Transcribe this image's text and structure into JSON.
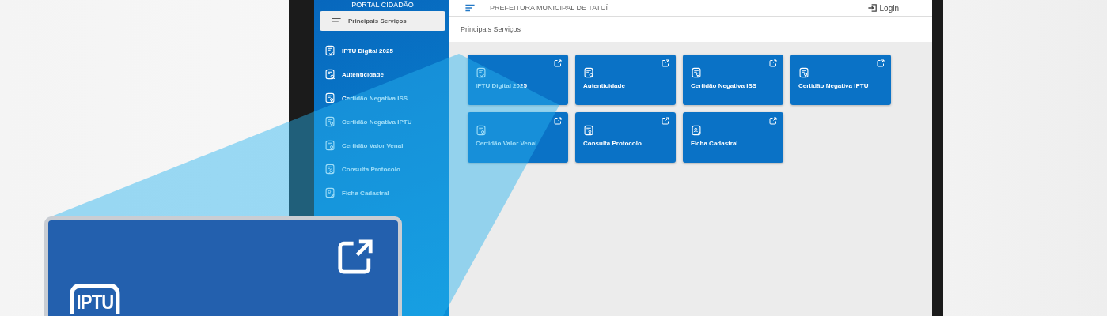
{
  "header": {
    "title": "PREFEITURA MUNICIPAL DE TATUÍ",
    "login": "Login"
  },
  "sidebar": {
    "title": "PORTAL CIDADÃO",
    "items": [
      {
        "label": "Principais Serviços",
        "kind": "menu",
        "selected": true
      },
      {
        "label": "IPTU Digital 2025",
        "kind": "iptu",
        "selected": false
      },
      {
        "label": "Autenticidade",
        "kind": "verify",
        "selected": false
      },
      {
        "label": "Certidão Negativa ISS",
        "kind": "certificate",
        "selected": false
      },
      {
        "label": "Certidão Negativa IPTU",
        "kind": "certificate",
        "selected": false
      },
      {
        "label": "Certidão Valor Venal",
        "kind": "certificate",
        "selected": false
      },
      {
        "label": "Consulta Protocolo",
        "kind": "protocol",
        "selected": false
      },
      {
        "label": "Ficha Cadastral",
        "kind": "profile",
        "selected": false
      }
    ]
  },
  "breadcrumb": "Principais Serviços",
  "cards": [
    {
      "title": "IPTU Digital 2025",
      "kind": "iptu"
    },
    {
      "title": "Autenticidade",
      "kind": "verify"
    },
    {
      "title": "Certidão Negativa ISS",
      "kind": "certificate"
    },
    {
      "title": "Certidão Negativa IPTU",
      "kind": "certificate"
    },
    {
      "title": "Certidão Valor Venal",
      "kind": "certificate"
    },
    {
      "title": "Consulta Protocolo",
      "kind": "protocol"
    },
    {
      "title": "Ficha Cadastral",
      "kind": "profile"
    }
  ],
  "callout": {
    "icon_text": "IPTU"
  }
}
